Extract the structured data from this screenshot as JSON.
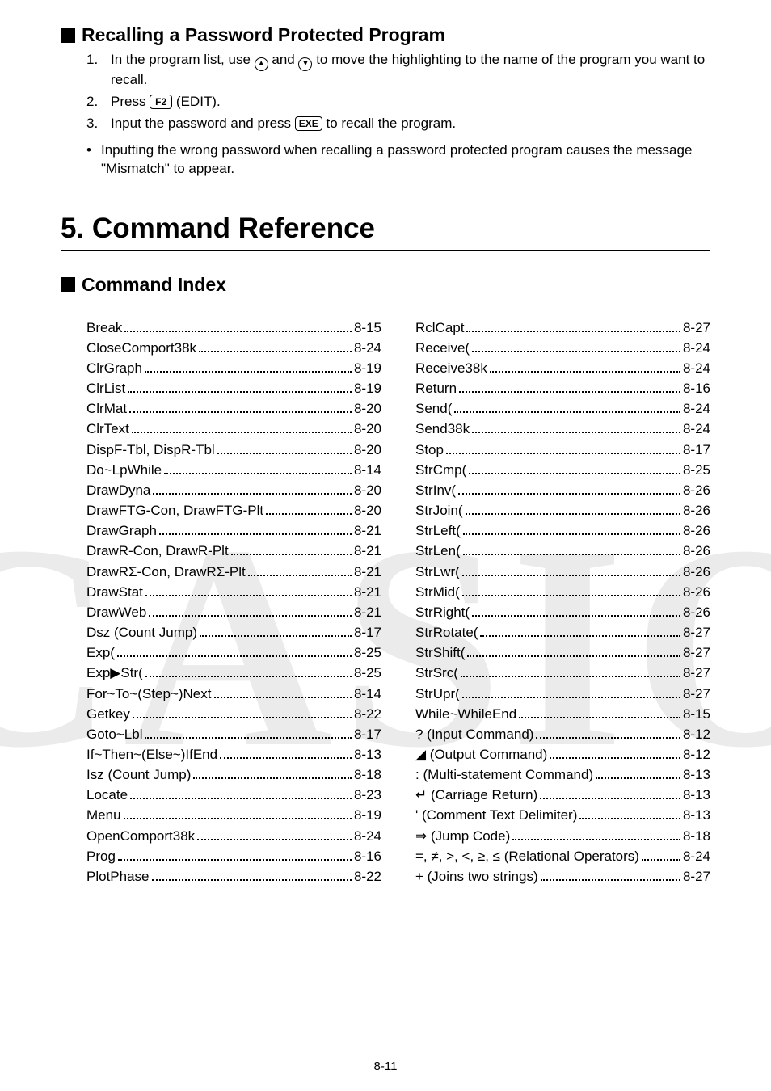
{
  "section1": {
    "title": "Recalling a Password Protected Program",
    "steps": [
      {
        "n": "1.",
        "t_pre": "In the program list, use ",
        "k1": "▲",
        "t_mid": " and ",
        "k2": "▼",
        "t_post": " to move the highlighting to the name of the program you want to recall."
      },
      {
        "n": "2.",
        "t_pre": "Press ",
        "k1": "F2",
        "t_post": "(EDIT)."
      },
      {
        "n": "3.",
        "t_pre": "Input the password and press ",
        "k1": "EXE",
        "t_post": " to recall the program."
      }
    ],
    "bullet": "Inputting the wrong password when recalling a password protected program causes the message \"Mismatch\" to appear."
  },
  "h1": "5. Command Reference",
  "section2_title": "Command Index",
  "index_left": [
    {
      "l": "Break",
      "p": "8-15"
    },
    {
      "l": "CloseComport38k",
      "p": "8-24"
    },
    {
      "l": "ClrGraph",
      "p": "8-19"
    },
    {
      "l": "ClrList",
      "p": "8-19"
    },
    {
      "l": "ClrMat",
      "p": "8-20"
    },
    {
      "l": "ClrText",
      "p": "8-20"
    },
    {
      "l": "DispF-Tbl, DispR-Tbl",
      "p": "8-20"
    },
    {
      "l": "Do~LpWhile",
      "p": "8-14"
    },
    {
      "l": "DrawDyna",
      "p": "8-20"
    },
    {
      "l": "DrawFTG-Con, DrawFTG-Plt",
      "p": "8-20"
    },
    {
      "l": "DrawGraph",
      "p": "8-21"
    },
    {
      "l": "DrawR-Con, DrawR-Plt",
      "p": "8-21"
    },
    {
      "l": "DrawRΣ-Con, DrawRΣ-Plt",
      "p": "8-21"
    },
    {
      "l": "DrawStat",
      "p": "8-21"
    },
    {
      "l": "DrawWeb",
      "p": "8-21"
    },
    {
      "l": "Dsz (Count Jump)",
      "p": "8-17"
    },
    {
      "l": "Exp(",
      "p": "8-25"
    },
    {
      "l": "Exp▶Str(",
      "p": "8-25"
    },
    {
      "l": "For~To~(Step~)Next",
      "p": "8-14"
    },
    {
      "l": "Getkey",
      "p": "8-22"
    },
    {
      "l": "Goto~Lbl",
      "p": "8-17"
    },
    {
      "l": "If~Then~(Else~)IfEnd",
      "p": "8-13"
    },
    {
      "l": "Isz (Count Jump)",
      "p": "8-18"
    },
    {
      "l": "Locate",
      "p": "8-23"
    },
    {
      "l": "Menu",
      "p": "8-19"
    },
    {
      "l": "OpenComport38k",
      "p": "8-24"
    },
    {
      "l": "Prog",
      "p": "8-16"
    },
    {
      "l": "PlotPhase",
      "p": "8-22"
    }
  ],
  "index_right": [
    {
      "l": "RclCapt",
      "p": "8-27"
    },
    {
      "l": "Receive(",
      "p": "8-24"
    },
    {
      "l": "Receive38k",
      "p": "8-24"
    },
    {
      "l": "Return",
      "p": "8-16"
    },
    {
      "l": "Send(",
      "p": "8-24"
    },
    {
      "l": "Send38k",
      "p": "8-24"
    },
    {
      "l": "Stop",
      "p": "8-17"
    },
    {
      "l": "StrCmp(",
      "p": "8-25"
    },
    {
      "l": "StrInv(",
      "p": "8-26"
    },
    {
      "l": "StrJoin(",
      "p": "8-26"
    },
    {
      "l": "StrLeft(",
      "p": "8-26"
    },
    {
      "l": "StrLen(",
      "p": "8-26"
    },
    {
      "l": "StrLwr(",
      "p": "8-26"
    },
    {
      "l": "StrMid(",
      "p": "8-26"
    },
    {
      "l": "StrRight(",
      "p": "8-26"
    },
    {
      "l": "StrRotate(",
      "p": "8-27"
    },
    {
      "l": "StrShift(",
      "p": "8-27"
    },
    {
      "l": "StrSrc(",
      "p": "8-27"
    },
    {
      "l": "StrUpr(",
      "p": "8-27"
    },
    {
      "l": "While~WhileEnd",
      "p": "8-15"
    },
    {
      "l": "? (Input Command)",
      "p": "8-12"
    },
    {
      "l": "◢ (Output Command)",
      "p": "8-12"
    },
    {
      "l": ": (Multi-statement Command)",
      "p": "8-13"
    },
    {
      "l": "↵ (Carriage Return)",
      "p": "8-13"
    },
    {
      "l": "' (Comment Text Delimiter)",
      "p": "8-13"
    },
    {
      "l": "⇒ (Jump Code)",
      "p": "8-18"
    },
    {
      "l": "=, ≠, >, <, ≥, ≤ (Relational Operators)",
      "p": "8-24"
    },
    {
      "l": "+ (Joins two strings)",
      "p": "8-27"
    }
  ],
  "footer": "8-11"
}
